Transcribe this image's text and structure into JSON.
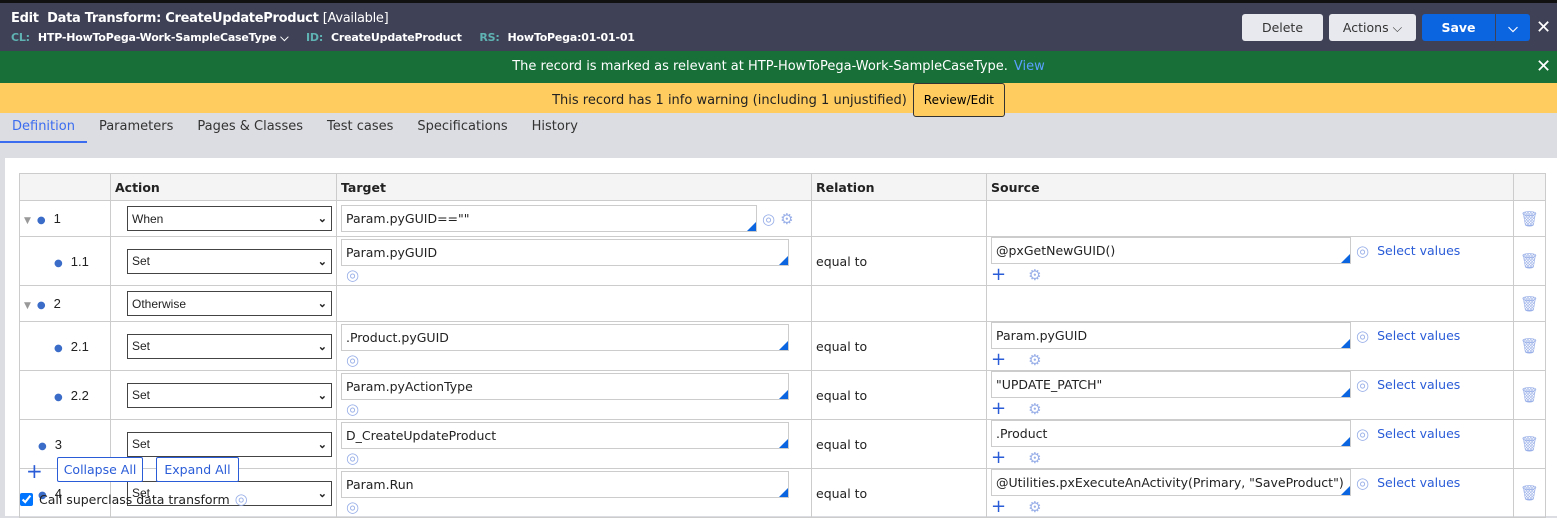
{
  "header": {
    "edit": "Edit",
    "title": "Data Transform: CreateUpdateProduct",
    "status": "[Available]",
    "cl_label": "CL:",
    "cl_value": "HTP-HowToPega-Work-SampleCaseType",
    "id_label": "ID:",
    "id_value": "CreateUpdateProduct",
    "rs_label": "RS:",
    "rs_value": "HowToPega:01-01-01",
    "delete": "Delete",
    "actions": "Actions",
    "save": "Save"
  },
  "banner": {
    "message": "The record is marked as relevant at HTP-HowToPega-Work-SampleCaseType.",
    "link": "View"
  },
  "warning": {
    "message": "This record has 1 info warning (including 1 unjustified)",
    "button": "Review/Edit"
  },
  "tabs": [
    "Definition",
    "Parameters",
    "Pages & Classes",
    "Test cases",
    "Specifications",
    "History"
  ],
  "table": {
    "headers": [
      "",
      "Action",
      "Target",
      "Relation",
      "Source",
      ""
    ],
    "select_values": "Select values",
    "rows": [
      {
        "num": "1",
        "expand": true,
        "indent": false,
        "action": "When",
        "target": "Param.pyGUID==\"\"",
        "relation": "",
        "source": ""
      },
      {
        "num": "1.1",
        "expand": false,
        "indent": true,
        "action": "Set",
        "target": "Param.pyGUID",
        "relation": "equal to",
        "source": "@pxGetNewGUID()"
      },
      {
        "num": "2",
        "expand": true,
        "indent": false,
        "action": "Otherwise",
        "target": "",
        "relation": "",
        "source": ""
      },
      {
        "num": "2.1",
        "expand": false,
        "indent": true,
        "action": "Set",
        "target": ".Product.pyGUID",
        "relation": "equal to",
        "source": "Param.pyGUID"
      },
      {
        "num": "2.2",
        "expand": false,
        "indent": true,
        "action": "Set",
        "target": "Param.pyActionType",
        "relation": "equal to",
        "source": "\"UPDATE_PATCH\""
      },
      {
        "num": "3",
        "expand": false,
        "indent": false,
        "action": "Set",
        "target": "D_CreateUpdateProduct",
        "relation": "equal to",
        "source": ".Product"
      },
      {
        "num": "4",
        "expand": false,
        "indent": false,
        "action": "Set",
        "target": "Param.Run",
        "relation": "equal to",
        "source": "@Utilities.pxExecuteAnActivity(Primary, \"SaveProduct\")"
      }
    ]
  },
  "footer": {
    "collapse_all": "Collapse All",
    "expand_all": "Expand All",
    "superclass_label": "Call superclass data transform",
    "superclass_checked": true
  }
}
